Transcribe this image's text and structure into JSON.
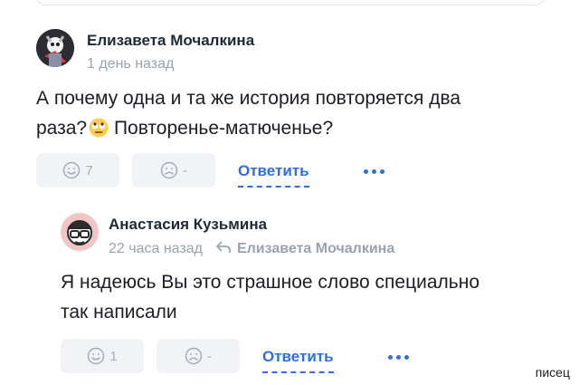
{
  "comments": [
    {
      "author": "Елизавета Мочалкина",
      "time": "1 день назад",
      "text_line1": "А почему одна и та же история повторяется два",
      "text_line2_a": "раза?",
      "text_line2_b": " Повторенье-матюченье?",
      "emoji": "face-with-rolling-eyes",
      "like_count": "7",
      "dislike_count": "-",
      "reply_label": "Ответить"
    },
    {
      "author": "Анастасия Кузьмина",
      "time": "22 часа назад",
      "reply_to": "Елизавета Мочалкина",
      "text_line1": "Я надеюсь Вы это страшное слово специально",
      "text_line2": "так написали",
      "like_count": "1",
      "dislike_count": "-",
      "reply_label": "Ответить"
    }
  ],
  "watermark": "писец",
  "colors": {
    "accent": "#2f6ee0",
    "muted": "#9aa3ad",
    "pill_bg": "#f1f3f6"
  }
}
